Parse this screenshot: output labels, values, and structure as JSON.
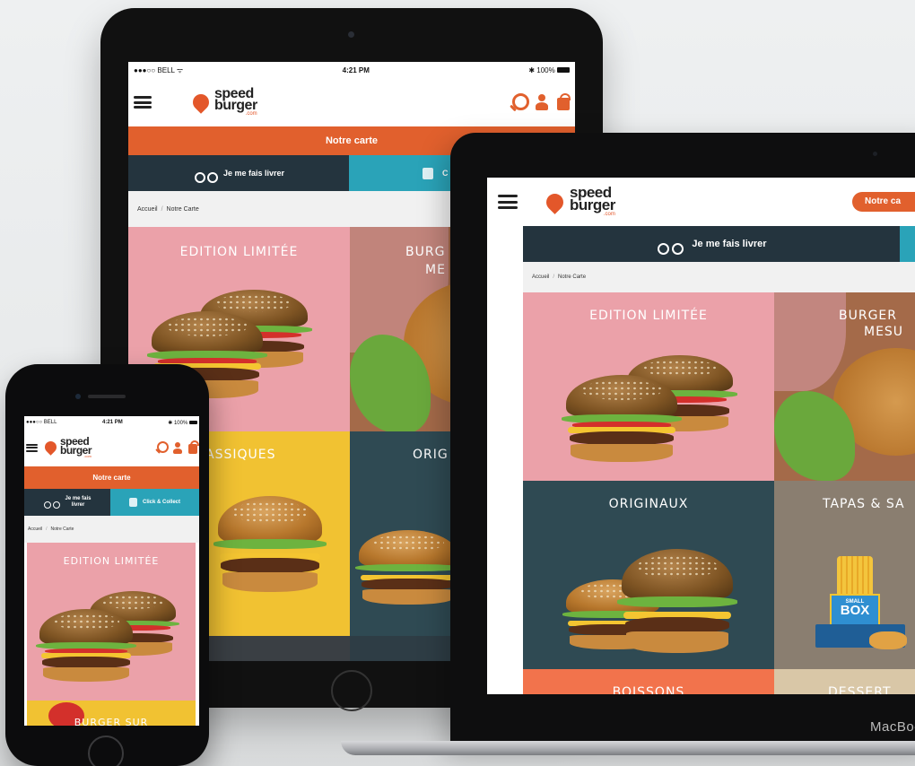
{
  "status": {
    "carrier": "BELL",
    "time": "4:21 PM",
    "battery": "100%"
  },
  "site": {
    "logo": {
      "line1": "speed",
      "line2": "burger",
      "suffix": ".com"
    },
    "nav_label": "Notre carte",
    "delivery_label": "Je me fais livrer",
    "collect_label": "Click & Collect",
    "collect_partial": "C",
    "breadcrumb": {
      "home": "Accueil",
      "current": "Notre Carte"
    }
  },
  "ipad_tiles": [
    "EDITION LIMITÉE",
    "BURG",
    "ME",
    "ASSIQUES",
    "ORIG"
  ],
  "mac": {
    "nav_partial": "Notre ca",
    "tiles": [
      "EDITION LIMITÉE",
      "BURGER",
      "MESU",
      "ORIGINAUX",
      "TAPAS & SA",
      "BOISSONS",
      "DESSERT"
    ],
    "box_label": {
      "l1": "SMALL",
      "l2": "BOX"
    },
    "brand": "MacBoo"
  },
  "iphone": {
    "delivery_l1": "Je me fais",
    "delivery_l2": "livrer",
    "tiles": [
      "EDITION LIMITÉE",
      "BURGER SUR"
    ]
  },
  "colors": {
    "orange": "#e1602d",
    "navy": "#24343e",
    "teal": "#2aa3b8",
    "pink": "#eba1a9",
    "yellow": "#f1c232",
    "slate": "#2f4a53",
    "taupe": "#8a7e70",
    "sand": "#d9c7a7"
  }
}
